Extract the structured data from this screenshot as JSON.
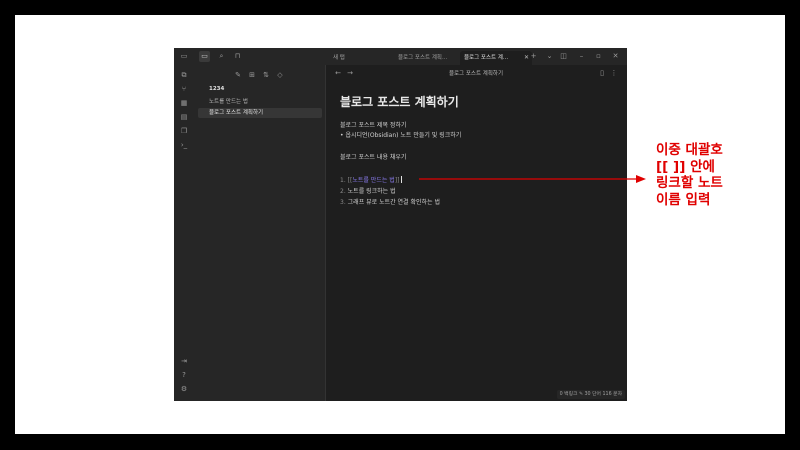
{
  "tabs": [
    {
      "label": "새 탭",
      "active": false
    },
    {
      "label": "블로그 포스트 계획...",
      "active": false
    },
    {
      "label": "블로그 포스트 계...",
      "active": true
    }
  ],
  "tab_close_glyph": "✕",
  "new_tab_glyph": "+",
  "sidebar": {
    "vault_name": "1234",
    "files": [
      {
        "label": "노트를 만드는 법",
        "active": false
      },
      {
        "label": "블로그 포스트 계획하기",
        "active": true
      }
    ]
  },
  "nav": {
    "back_glyph": "←",
    "forward_glyph": "→",
    "title": "블로그 포스트 계획하기"
  },
  "document": {
    "title": "블로그 포스트 계획하기",
    "subheading": "블로그 포스트 제목 정하기",
    "bullet": "• 옵시디언(Obsidian) 노트 만들기 및 링크하기",
    "section": "블로그 포스트 내용 채우기",
    "list": [
      {
        "num": "1.",
        "prefix": "[[",
        "link": "노트를 만드는 법",
        "suffix": "]]"
      },
      {
        "num": "2.",
        "text": "노트를 링크하는 법"
      },
      {
        "num": "3.",
        "text": "그래프 뷰로 노트간 연결 확인하는 법"
      }
    ]
  },
  "status": {
    "backlinks": "0 백링크",
    "words": "30 단어",
    "chars": "116 문자"
  },
  "annotation": {
    "text": "이중 대괄호\n[[ ]] 안에\n링크할 노트\n이름 입력",
    "color": "#e00000"
  },
  "icons": {
    "ribbon_top": [
      "files-icon",
      "graph-icon",
      "canvas-icon",
      "calendar-icon",
      "copy-icon",
      "terminal-icon"
    ],
    "ribbon_bottom": [
      "vault-icon",
      "help-icon",
      "settings-icon"
    ]
  },
  "colors": {
    "background": "#1e1e1e",
    "sidebar": "#262626",
    "link": "#8a7cf0",
    "accent_red": "#e00000"
  }
}
